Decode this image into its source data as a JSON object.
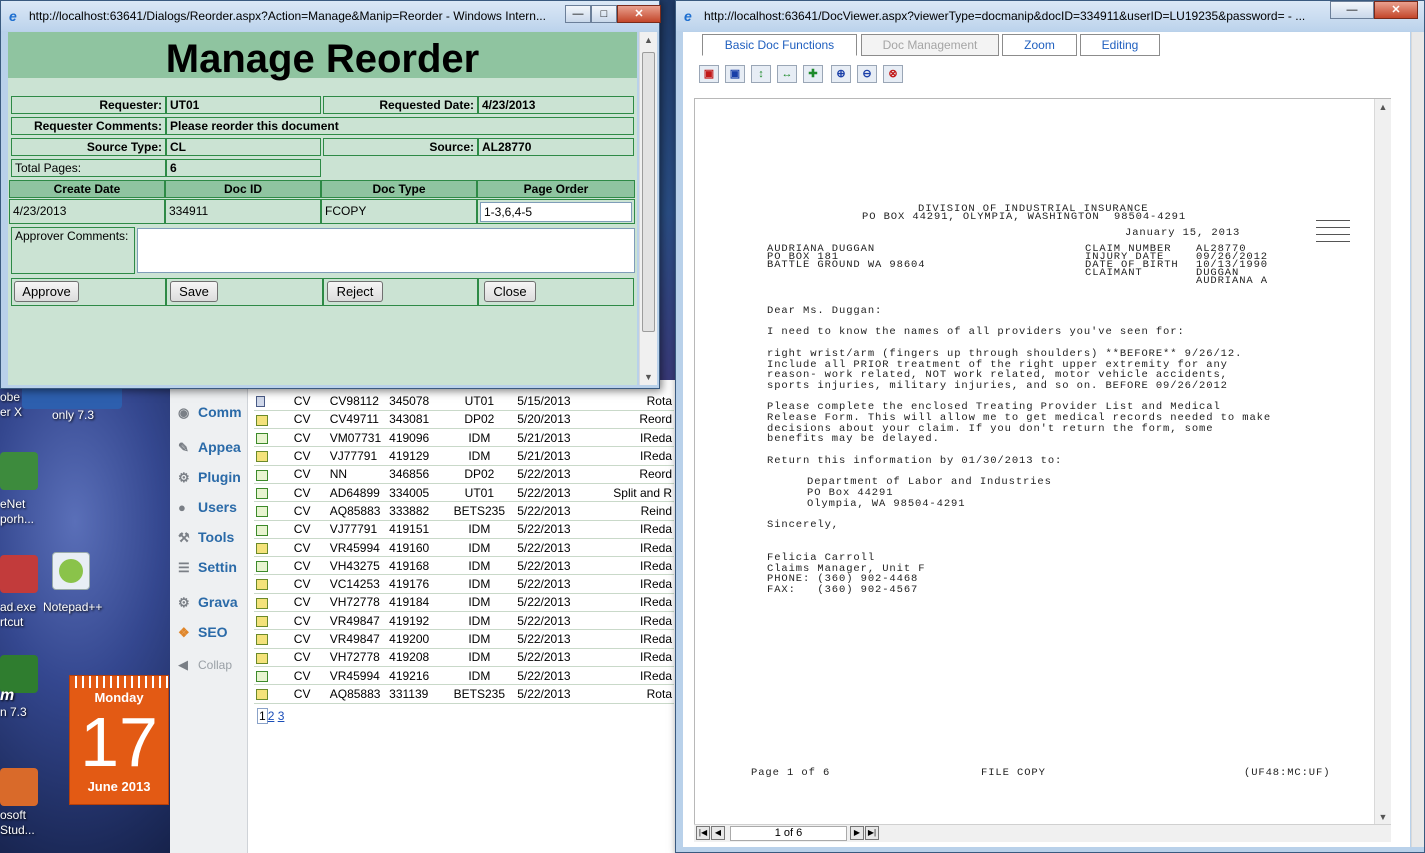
{
  "desktop": {
    "icons": [
      {
        "label": "obe"
      },
      {
        "label": "er X"
      },
      {
        "label": "eNet"
      },
      {
        "label": "porh..."
      },
      {
        "label": "ad.exe"
      },
      {
        "label": "rtcut"
      },
      {
        "label": "Notepad++"
      },
      {
        "label": "m"
      },
      {
        "label": "n 7.3"
      },
      {
        "label": "osoft"
      },
      {
        "label": "Stud..."
      },
      {
        "label": "only 7.3"
      }
    ],
    "calendar": {
      "weekday": "Monday",
      "day": "17",
      "month_year": "June 2013"
    }
  },
  "background_page": {
    "sidebar": [
      {
        "label": "Comm",
        "icon": "comments-icon"
      },
      {
        "label": "Appea",
        "icon": "appearance-icon"
      },
      {
        "label": "Plugin",
        "icon": "plugins-icon"
      },
      {
        "label": "Users",
        "icon": "users-icon"
      },
      {
        "label": "Tools",
        "icon": "tools-icon"
      },
      {
        "label": "Settin",
        "icon": "settings-icon"
      },
      {
        "label": "Grava",
        "icon": "gravatar-icon"
      },
      {
        "label": "SEO",
        "icon": "seo-icon"
      },
      {
        "label": "Collap",
        "icon": "collapse-icon"
      }
    ],
    "rows": [
      {
        "icon": "lock",
        "src": "CV",
        "claim": "CV98112",
        "doc": "345078",
        "user": "UT01",
        "date": "5/15/2013",
        "action": "Rota"
      },
      {
        "icon": "mail",
        "src": "CV",
        "claim": "CV49711",
        "doc": "343081",
        "user": "DP02",
        "date": "5/20/2013",
        "action": "Reord"
      },
      {
        "icon": "check",
        "src": "CV",
        "claim": "VM07731",
        "doc": "419096",
        "user": "IDM",
        "date": "5/21/2013",
        "action": "IReda"
      },
      {
        "icon": "mail",
        "src": "CV",
        "claim": "VJ77791",
        "doc": "419129",
        "user": "IDM",
        "date": "5/21/2013",
        "action": "IReda"
      },
      {
        "icon": "check",
        "src": "CV",
        "claim": "NN",
        "doc": "346856",
        "user": "DP02",
        "date": "5/22/2013",
        "action": "Reord"
      },
      {
        "icon": "check",
        "src": "CV",
        "claim": "AD64899",
        "doc": "334005",
        "user": "UT01",
        "date": "5/22/2013",
        "action": "Split and R"
      },
      {
        "icon": "check",
        "src": "CV",
        "claim": "AQ85883",
        "doc": "333882",
        "user": "BETS235",
        "date": "5/22/2013",
        "action": "Reind"
      },
      {
        "icon": "check",
        "src": "CV",
        "claim": "VJ77791",
        "doc": "419151",
        "user": "IDM",
        "date": "5/22/2013",
        "action": "IReda"
      },
      {
        "icon": "mail",
        "src": "CV",
        "claim": "VR45994",
        "doc": "419160",
        "user": "IDM",
        "date": "5/22/2013",
        "action": "IReda"
      },
      {
        "icon": "check",
        "src": "CV",
        "claim": "VH43275",
        "doc": "419168",
        "user": "IDM",
        "date": "5/22/2013",
        "action": "IReda"
      },
      {
        "icon": "mail",
        "src": "CV",
        "claim": "VC14253",
        "doc": "419176",
        "user": "IDM",
        "date": "5/22/2013",
        "action": "IReda"
      },
      {
        "icon": "mail",
        "src": "CV",
        "claim": "VH72778",
        "doc": "419184",
        "user": "IDM",
        "date": "5/22/2013",
        "action": "IReda"
      },
      {
        "icon": "mail",
        "src": "CV",
        "claim": "VR49847",
        "doc": "419192",
        "user": "IDM",
        "date": "5/22/2013",
        "action": "IReda"
      },
      {
        "icon": "mail",
        "src": "CV",
        "claim": "VR49847",
        "doc": "419200",
        "user": "IDM",
        "date": "5/22/2013",
        "action": "IReda"
      },
      {
        "icon": "mail",
        "src": "CV",
        "claim": "VH72778",
        "doc": "419208",
        "user": "IDM",
        "date": "5/22/2013",
        "action": "IReda"
      },
      {
        "icon": "check",
        "src": "CV",
        "claim": "VR45994",
        "doc": "419216",
        "user": "IDM",
        "date": "5/22/2013",
        "action": "IReda"
      },
      {
        "icon": "mail",
        "src": "CV",
        "claim": "AQ85883",
        "doc": "331139",
        "user": "BETS235",
        "date": "5/22/2013",
        "action": "Rota"
      }
    ],
    "pager": {
      "current": "1",
      "pages": [
        "2",
        "3"
      ]
    }
  },
  "reorder_window": {
    "title": "http://localhost:63641/Dialogs/Reorder.aspx?Action=Manage&Manip=Reorder - Windows Intern...",
    "heading": "Manage Reorder",
    "requester_label": "Requester:",
    "requester_value": "UT01",
    "requested_date_label": "Requested Date:",
    "requested_date_value": "4/23/2013",
    "requester_comments_label": "Requester Comments:",
    "requester_comments_value": "Please reorder this document",
    "source_type_label": "Source Type:",
    "source_type_value": "CL",
    "source_label": "Source:",
    "source_value": "AL28770",
    "total_pages_label": "Total Pages:",
    "total_pages_value": "6",
    "columns": [
      "Create Date",
      "Doc ID",
      "Doc Type",
      "Page Order"
    ],
    "row": {
      "create_date": "4/23/2013",
      "doc_id": "334911",
      "doc_type": "FCOPY",
      "page_order": "1-3,6,4-5"
    },
    "approver_comments_label": "Approver Comments:",
    "approver_comments_value": "",
    "buttons": {
      "approve": "Approve",
      "save": "Save",
      "reject": "Reject",
      "close": "Close"
    }
  },
  "viewer_window": {
    "title": "http://localhost:63641/DocViewer.aspx?viewerType=docmanip&docID=334911&userID=LU19235&password= - ...",
    "tabs": {
      "basic": "Basic Doc Functions",
      "management": "Doc Management",
      "zoom": "Zoom",
      "editing": "Editing"
    },
    "tools": [
      "rotate-left-icon",
      "rotate-right-icon",
      "flip-vertical-icon",
      "flip-horizontal-icon",
      "move-icon",
      "zoom-in-icon",
      "zoom-out-icon",
      "zoom-reset-icon"
    ],
    "doc": {
      "l1": "DIVISION OF INDUSTRIAL INSURANCE",
      "l2": "PO BOX 44291, OLYMPIA, WASHINGTON  98504-4291",
      "date": "January 15, 2013",
      "addr1": "AUDRIANA DUGGAN",
      "addr2": "PO BOX 181",
      "addr3": "BATTLE GROUND WA 98604",
      "claim_label": "CLAIM NUMBER",
      "claim_val": "AL28770",
      "injury_label": "INJURY DATE",
      "injury_val": "09/26/2012",
      "dob_label": "DATE OF BIRTH",
      "dob_val": "10/13/1990",
      "claimant_label": "CLAIMANT",
      "claimant_val1": "DUGGAN",
      "claimant_val2": "AUDRIANA A",
      "salutation": "Dear Ms. Duggan:",
      "p1": "I need to know the names of all providers you've seen for:",
      "p2a": "right wrist/arm (fingers up through shoulders) **BEFORE** 9/26/12.",
      "p2b": "Include all PRIOR treatment of the right upper extremity for any",
      "p2c": "reason- work related, NOT work related, motor vehicle accidents,",
      "p2d": "sports injuries, military injuries, and so on. BEFORE 09/26/2012",
      "p3a": "Please complete the enclosed Treating Provider List and Medical",
      "p3b": "Release Form. This will allow me to get medical records needed to make",
      "p3c": "decisions about your claim. If you don't return the form, some",
      "p3d": "benefits may be delayed.",
      "p4": "Return this information by 01/30/2013 to:",
      "r1": "Department of Labor and Industries",
      "r2": "PO Box 44291",
      "r3": "Olympia, WA 98504-4291",
      "closing": "Sincerely,",
      "s1": "Felicia Carroll",
      "s2": "Claims Manager, Unit F",
      "s3": "PHONE: (360) 902-4468",
      "s4": "FAX:   (360) 902-4567",
      "footer_page": "Page 1 of 6",
      "footer_copy": "FILE COPY",
      "footer_code": "(UF48:MC:UF)"
    },
    "page_indicator": "1 of 6"
  }
}
